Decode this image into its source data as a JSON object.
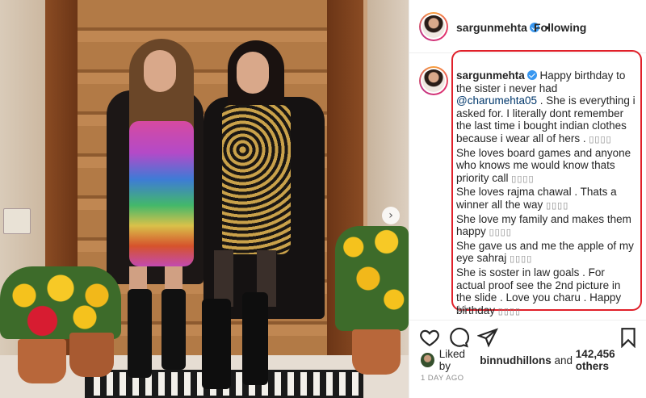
{
  "post": {
    "username": "sargunmehta",
    "follow_status": "Following",
    "separator": "•"
  },
  "caption": {
    "username": "sargunmehta",
    "text_1": "Happy birthday to the sister i never had",
    "mention": "@charumehta05",
    "text_2": ". She is everything i asked for. I literally dont remember the last time i bought indian clothes because i wear all of hers .",
    "line_3": "She loves board games and anyone who knows me would know thats priority call",
    "line_4": "She loves rajma chawal . Thats a winner all the way",
    "line_5": "She love my family and makes them happy",
    "line_6": "She gave us and me the apple of my eye sahraj",
    "line_7": "She is soster in law goals . For actual proof see the 2nd picture in the slide . Love you charu . Happy birthday",
    "emoji_placeholder": "▯▯▯▯",
    "time": "1d"
  },
  "likes": {
    "prefix": "Liked by",
    "user": "binnudhillons",
    "conj": "and",
    "count": "142,456 others"
  },
  "date": "1 DAY AGO",
  "colors": {
    "verified": "#3897f0",
    "highlight_box": "#e0202a",
    "mention": "#00376b"
  },
  "icons": [
    "heart-icon",
    "comment-icon",
    "share-icon",
    "bookmark-icon",
    "verified-badge-icon",
    "next-arrow-icon"
  ]
}
